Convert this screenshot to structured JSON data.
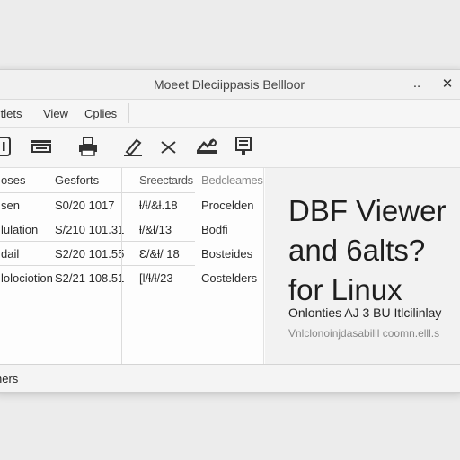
{
  "window": {
    "title": "Moeet Dleciippasis Bellloor",
    "minimize_glyph": "..",
    "close_glyph": "✕"
  },
  "menu": {
    "items": [
      {
        "label": "Itlets"
      },
      {
        "label": "View"
      },
      {
        "label": "Cplies"
      }
    ]
  },
  "toolbar": {
    "icons": [
      "info-icon",
      "table-icon",
      "print-icon",
      "edit-icon",
      "delete-icon",
      "tools-icon",
      "export-icon"
    ]
  },
  "table": {
    "headers": [
      "oses",
      "Gesforts",
      "Sreectards",
      "Bedcleames"
    ],
    "rows": [
      [
        "sen",
        "S0/20 1017",
        "ƚ/ƚ/&ƚ.18",
        "Procelden"
      ],
      [
        "lulation",
        "S/210 101.31",
        "ƚ/&ƚ/13",
        "Bodfi"
      ],
      [
        "dail",
        "S2/20 101.55",
        "Ɛ/&ƚ/ 18",
        "Bosteides"
      ],
      [
        "lolociotion",
        "S2/21 108.51",
        "[Ɩ/ƚ/ƚ/23",
        "Costelders"
      ]
    ]
  },
  "panel": {
    "headline": [
      "DBF Viewer",
      "and 6alts?",
      "for Linux"
    ],
    "subline1": "Onlonties AJ 3 BU Itlcilinlay",
    "subline2": "Vnlclonoinjdasabilll coomn.elll.s"
  },
  "status": {
    "text": "ners"
  }
}
